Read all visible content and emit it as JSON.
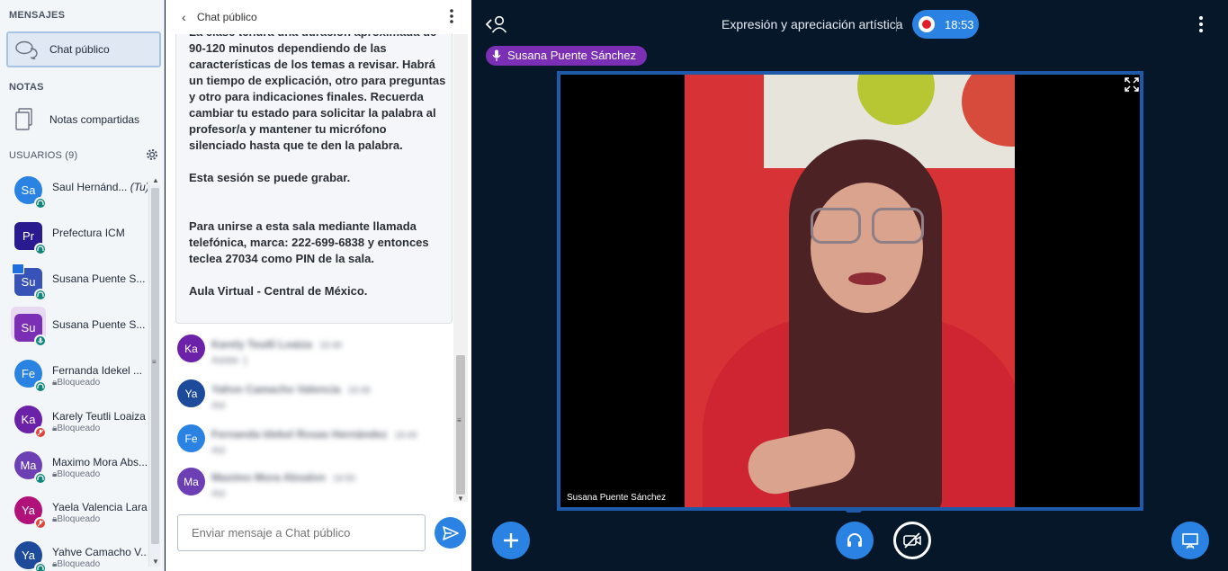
{
  "sidebar": {
    "messages_title": "MENSAJES",
    "chat_item": "Chat público",
    "notes_title": "NOTAS",
    "notes_item": "Notas compartidas",
    "users_title": "USUARIOS (9)",
    "users": [
      {
        "initials": "Sa",
        "name": "Saul Hernánd...",
        "suffix": "(Tu)",
        "status": "",
        "color": "#2a83e2",
        "shape": "round",
        "badge": "headset",
        "badge_color": "#10857a"
      },
      {
        "initials": "Pr",
        "name": "Prefectura ICM",
        "suffix": "",
        "status": "",
        "color": "#2a1a8f",
        "shape": "sq",
        "badge": "headset",
        "badge_color": "#10857a"
      },
      {
        "initials": "Su",
        "name": "Susana Puente S...",
        "suffix": "",
        "status": "",
        "color": "#3753b8",
        "shape": "sq",
        "badge": "headset",
        "badge_color": "#10857a"
      },
      {
        "initials": "Su",
        "name": "Susana Puente S...",
        "suffix": "",
        "status": "",
        "color": "#7b2fb5",
        "shape": "sq",
        "badge": "mic",
        "badge_color": "#10857a"
      },
      {
        "initials": "Fe",
        "name": "Fernanda Idekel ...",
        "suffix": "",
        "status": "Bloqueado",
        "color": "#2a83e2",
        "shape": "round",
        "badge": "headset",
        "badge_color": "#10857a"
      },
      {
        "initials": "Ka",
        "name": "Karely Teutli Loaiza",
        "suffix": "",
        "status": "Bloqueado",
        "color": "#6b21a8",
        "shape": "round",
        "badge": "mic-off",
        "badge_color": "#e0453b"
      },
      {
        "initials": "Ma",
        "name": "Maximo Mora Abs...",
        "suffix": "",
        "status": "Bloqueado",
        "color": "#6d3fb5",
        "shape": "round",
        "badge": "headset",
        "badge_color": "#10857a"
      },
      {
        "initials": "Ya",
        "name": "Yaela Valencia Lara",
        "suffix": "",
        "status": "Bloqueado",
        "color": "#b0127a",
        "shape": "round",
        "badge": "mic-off",
        "badge_color": "#e0453b"
      },
      {
        "initials": "Ya",
        "name": "Yahve Camacho V...",
        "suffix": "",
        "status": "Bloqueado",
        "color": "#1e4a9b",
        "shape": "round",
        "badge": "headset",
        "badge_color": "#10857a"
      }
    ]
  },
  "chat": {
    "title": "Chat público",
    "welcome_text": "La clase tendrá una duración aproximada de 90-120 minutos dependiendo de las características de los temas a revisar. Habrá un tiempo de explicación, otro para preguntas y otro para indicaciones finales. Recuerda cambiar tu estado para solicitar la palabra al profesor/a y mantener tu micrófono silenciado hasta que te den la palabra.\n\nEsta sesión se puede grabar.\n\n\nPara unirse a esta sala mediante llamada telefónica, marca: 222-699-6838 y entonces teclea 27034 como PIN de la sala.\n\nAula Virtual - Central de México.",
    "messages": [
      {
        "initials": "Ka",
        "color": "#6b21a8",
        "author": "Karely Teutli Loaiza",
        "time": "18:48",
        "text": "Asiste :)"
      },
      {
        "initials": "Ya",
        "color": "#1e4a9b",
        "author": "Yahve Camacho Valencia",
        "time": "18:48",
        "text": "Asi"
      },
      {
        "initials": "Fe",
        "color": "#2a83e2",
        "author": "Fernanda Idekel Rosas Hernández",
        "time": "18:49",
        "text": "Asi"
      },
      {
        "initials": "Ma",
        "color": "#6d3fb5",
        "author": "Maximo Mora Absalon",
        "time": "18:50",
        "text": "Asi"
      }
    ],
    "input_placeholder": "Enviar mensaje a Chat público"
  },
  "stage": {
    "meeting_title": "Expresión y apreciación artística",
    "recording_time": "18:53",
    "talker_name": "Susana Puente Sánchez",
    "video_label": "Susana Puente Sánchez"
  },
  "colors": {
    "accent": "#2a83e2",
    "stage_bg": "#06172a",
    "talker_bg": "#7b2fb5",
    "recording": "#e11d2b"
  }
}
